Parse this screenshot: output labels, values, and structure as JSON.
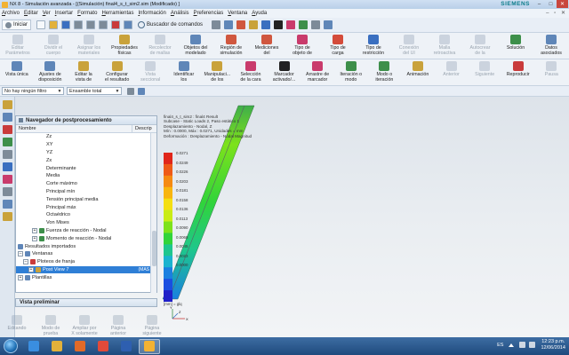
{
  "window": {
    "title": "NX 8 - Simulación avanzada - [(Simulación) final4_s_t_sim2.sim (Modificado) ]",
    "brand": "SIEMENS",
    "controls": {
      "minimize": "–",
      "maximize": "□",
      "close": "✕"
    }
  },
  "menubar": {
    "items": [
      "Archivo",
      "Editar",
      "Ver",
      "Insertar",
      "Formato",
      "Herramientas",
      "Información",
      "Análisis",
      "Preferencias",
      "Ventana",
      "Ayuda"
    ],
    "right": "– ▫ ✕"
  },
  "std_toolbar": {
    "start_label": "Iniciar",
    "search_label": "Buscador de comandos",
    "icons": [
      "new-icon",
      "open-icon",
      "save-icon",
      "cut-icon",
      "copy-icon",
      "paste-icon",
      "delete-icon",
      "undo-icon"
    ]
  },
  "ribbon1": {
    "buttons": [
      {
        "label": "Editar\nParámetros",
        "icon": "edit-params-icon",
        "color": "#8a9bb0",
        "enabled": false
      },
      {
        "label": "Dividir el\ncuerpo",
        "icon": "split-body-icon",
        "color": "#8a9bb0",
        "enabled": false
      },
      {
        "label": "Asignar los\nmateriales",
        "icon": "assign-material-icon",
        "color": "#8a9bb0",
        "enabled": false
      },
      {
        "label": "Propiedades\nfísicas",
        "icon": "physical-props-icon",
        "color": "#c9a23b",
        "enabled": true
      },
      {
        "label": "Recolector\nde mallas",
        "icon": "mesh-collector-icon",
        "color": "#8a9bb0",
        "enabled": false
      },
      {
        "label": "Objetos del\nmodelado",
        "icon": "modeling-objects-icon",
        "color": "#5f86b8",
        "enabled": true
      },
      {
        "label": "Región de\nsimulación",
        "icon": "sim-region-icon",
        "color": "#d0573f",
        "enabled": true
      },
      {
        "label": "Mediciones\ndel",
        "icon": "measurements-icon",
        "color": "#d0573f",
        "enabled": true
      },
      {
        "label": "Tipo de\nobjeto de",
        "icon": "object-type-icon",
        "color": "#c93b6c",
        "enabled": true
      },
      {
        "label": "Tipo de\ncarga",
        "icon": "load-type-icon",
        "color": "#d44b3a",
        "enabled": true
      },
      {
        "label": "Tipo de\nrestricción",
        "icon": "constraint-type-icon",
        "color": "#3a6fc0",
        "enabled": true
      },
      {
        "label": "Conexión\ndel UI",
        "icon": "connection-icon",
        "color": "#8a9bb0",
        "enabled": false
      },
      {
        "label": "Malla\nretroactiva",
        "icon": "mesh-retro-icon",
        "color": "#8a9bb0",
        "enabled": false
      },
      {
        "label": "Autocrear\nde la",
        "icon": "autocreate-icon",
        "color": "#8a9bb0",
        "enabled": false
      },
      {
        "label": "Solución",
        "icon": "solution-icon",
        "color": "#3d8f4a",
        "enabled": true
      },
      {
        "label": "Datos\nasociados",
        "icon": "associated-data-icon",
        "color": "#5f86b8",
        "enabled": true
      }
    ]
  },
  "ribbon2": {
    "buttons": [
      {
        "label": "Vista única",
        "icon": "single-view-icon",
        "color": "#5f86b8",
        "enabled": true
      },
      {
        "label": "Ajustes de\ndisposición",
        "icon": "layout-settings-icon",
        "color": "#5f86b8",
        "enabled": true
      },
      {
        "label": "Editar la\nvista de",
        "icon": "edit-view-icon",
        "color": "#c9a23b",
        "enabled": true
      },
      {
        "label": "Configurar\nel resultado",
        "icon": "configure-result-icon",
        "color": "#c9a23b",
        "enabled": true
      },
      {
        "label": "Vista\nseccional",
        "icon": "section-view-icon",
        "color": "#8a9bb0",
        "enabled": false
      },
      {
        "label": "Identificar\nlos",
        "icon": "identify-icon",
        "color": "#5f86b8",
        "enabled": true
      },
      {
        "label": "Manipulaci...\nde los",
        "icon": "manipulate-icon",
        "color": "#c9a23b",
        "enabled": true
      },
      {
        "label": "Selección\nde la cara",
        "icon": "face-select-icon",
        "color": "#c93b6c",
        "enabled": true
      },
      {
        "label": "Marcador\nactivado/...",
        "icon": "marker-toggle-icon",
        "color": "#222222",
        "enabled": true
      },
      {
        "label": "Arrastre de\nmarcador",
        "icon": "drag-marker-icon",
        "color": "#c93b6c",
        "enabled": true
      },
      {
        "label": "Iteración o\nmodo",
        "icon": "iteration-mode-icon",
        "color": "#3d8f4a",
        "enabled": true
      },
      {
        "label": "Modo o\niteración",
        "icon": "mode-iteration-icon",
        "color": "#3d8f4a",
        "enabled": true
      },
      {
        "label": "Animación",
        "icon": "animation-icon",
        "color": "#c9a23b",
        "enabled": true
      },
      {
        "label": "Anterior",
        "icon": "previous-icon",
        "color": "#8a9bb0",
        "enabled": false
      },
      {
        "label": "Siguiente",
        "icon": "next-icon",
        "color": "#8a9bb0",
        "enabled": false
      },
      {
        "label": "Reproducir",
        "icon": "play-icon",
        "color": "#c93b3b",
        "enabled": true
      },
      {
        "label": "Pausa",
        "icon": "pause-icon",
        "color": "#8a9bb0",
        "enabled": false
      }
    ]
  },
  "filterbar": {
    "filter_value": "No hay ningún filtro",
    "assembly_value": "Ensamble total"
  },
  "navigator": {
    "title": "Navegador de postprocesamiento",
    "col_name": "Nombre",
    "col_desc": "Descrip",
    "rows": [
      {
        "label": "Zz",
        "indent": 34,
        "icon": "",
        "exp": "",
        "selected": false,
        "extra": ""
      },
      {
        "label": "XY",
        "indent": 34,
        "icon": "",
        "exp": "",
        "selected": false,
        "extra": ""
      },
      {
        "label": "YZ",
        "indent": 34,
        "icon": "",
        "exp": "",
        "selected": false,
        "extra": ""
      },
      {
        "label": "Zx",
        "indent": 34,
        "icon": "",
        "exp": "",
        "selected": false,
        "extra": ""
      },
      {
        "label": "Determinante",
        "indent": 34,
        "icon": "",
        "exp": "",
        "selected": false,
        "extra": ""
      },
      {
        "label": "Media",
        "indent": 34,
        "icon": "",
        "exp": "",
        "selected": false,
        "extra": ""
      },
      {
        "label": "Corte máximo",
        "indent": 34,
        "icon": "",
        "exp": "",
        "selected": false,
        "extra": ""
      },
      {
        "label": "Principal mín",
        "indent": 34,
        "icon": "",
        "exp": "",
        "selected": false,
        "extra": ""
      },
      {
        "label": "Tensión principal media",
        "indent": 34,
        "icon": "",
        "exp": "",
        "selected": false,
        "extra": ""
      },
      {
        "label": "Principal máx",
        "indent": 34,
        "icon": "",
        "exp": "",
        "selected": false,
        "extra": ""
      },
      {
        "label": "Octaédrico",
        "indent": 34,
        "icon": "",
        "exp": "",
        "selected": false,
        "extra": ""
      },
      {
        "label": "Von Mises",
        "indent": 34,
        "icon": "",
        "exp": "",
        "selected": false,
        "extra": ""
      },
      {
        "label": "Fuerza de reacción - Nodal",
        "indent": 18,
        "icon": "#3d8f4a",
        "exp": "+",
        "selected": false,
        "extra": ""
      },
      {
        "label": "Momento de reacción - Nodal",
        "indent": 18,
        "icon": "#3d8f4a",
        "exp": "+",
        "selected": false,
        "extra": ""
      },
      {
        "label": "Resultados importados",
        "indent": 2,
        "icon": "#5f86b8",
        "exp": "",
        "selected": false,
        "extra": ""
      },
      {
        "label": "Ventanas",
        "indent": 2,
        "icon": "#5f86b8",
        "exp": "–",
        "selected": false,
        "extra": ""
      },
      {
        "label": "Ploteos de franja",
        "indent": 8,
        "icon": "#c93b3b",
        "exp": "–",
        "selected": false,
        "extra": ""
      },
      {
        "label": "Post View 7",
        "indent": 14,
        "icon": "#c9a23b",
        "exp": "+",
        "selected": true,
        "extra": "(MAS"
      },
      {
        "label": "Plantillas",
        "indent": 2,
        "icon": "#5f86b8",
        "exp": "+",
        "selected": false,
        "extra": ""
      }
    ]
  },
  "preview": {
    "title": "Vista preliminar"
  },
  "anim_bar": {
    "buttons": [
      {
        "label": "Editando",
        "icon": "editing-icon"
      },
      {
        "label": "Modo de\nprueba",
        "icon": "test-mode-icon"
      },
      {
        "label": "Ampliar por\nX solamente",
        "icon": "zoom-x-icon"
      },
      {
        "label": "Página\nanterior",
        "icon": "page-prev-icon"
      },
      {
        "label": "Página\nsiguiente",
        "icon": "page-next-icon"
      }
    ]
  },
  "result_header": {
    "lines": [
      "final4_s_t_sim2 : final4 Result",
      "Subcase - Static Loads 2, Paso estático 1",
      "Desplazamiento - Nodal, Z",
      "Mín : 0.0000, Máx : 0.0271, Unidades = mm",
      "Deformación : Desplazamiento - Nodal Magnitud"
    ]
  },
  "legend": {
    "values": [
      "0.0271",
      "0.0249",
      "0.0226",
      "0.0203",
      "0.0181",
      "0.0158",
      "0.0136",
      "0.0113",
      "0.0090",
      "0.0068",
      "0.0045",
      "0.0023",
      "0.0000"
    ],
    "colors": [
      "#e0261a",
      "#ee5a17",
      "#f58a12",
      "#f8b50f",
      "#f4df12",
      "#c9ec16",
      "#7de21b",
      "#31d43a",
      "#1ec68e",
      "#1ab3cf",
      "#1a7fe0",
      "#1a4ee0",
      "#2020c8"
    ],
    "unit_line": "[mm] = glq"
  },
  "axes": {
    "x": "X",
    "y": "Y",
    "z": "Z"
  },
  "taskbar": {
    "apps": [
      {
        "name": "ie-app",
        "color": "#3a8ee0",
        "active": false
      },
      {
        "name": "explorer-app",
        "color": "#e2b13a",
        "active": false
      },
      {
        "name": "media-app",
        "color": "#e06a28",
        "active": false
      },
      {
        "name": "chrome-app",
        "color": "#e04a3a",
        "active": false
      },
      {
        "name": "word-app",
        "color": "#2e5fb0",
        "active": false
      },
      {
        "name": "nx-app",
        "color": "#f2b233",
        "active": true
      }
    ],
    "language": "ES",
    "time": "12:23 p.m.",
    "date": "12/06/2014"
  }
}
